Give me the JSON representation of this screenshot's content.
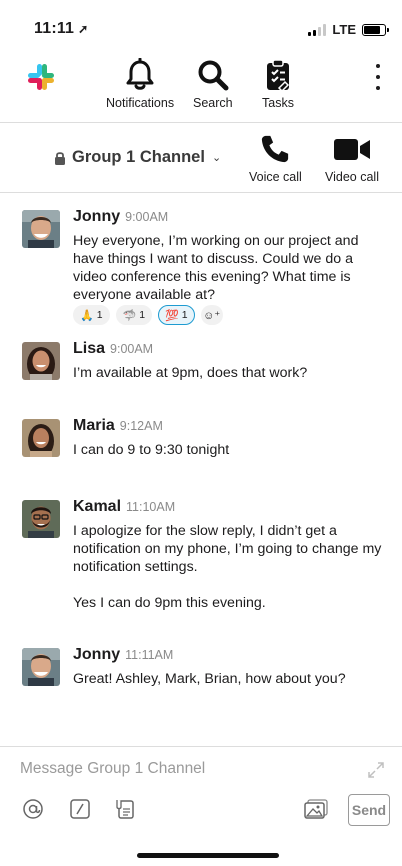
{
  "status_bar": {
    "time": "11:11",
    "network": "LTE"
  },
  "nav": {
    "notifications_label": "Notifications",
    "search_label": "Search",
    "tasks_label": "Tasks"
  },
  "channel": {
    "name": "Group 1 Channel",
    "voice_call_label": "Voice call",
    "video_call_label": "Video call"
  },
  "messages": [
    {
      "author": "Jonny",
      "time": "9:00AM",
      "text": "Hey everyone, I’m working on our project and have things I want to discuss.  Could we do a video conference this evening?  What time is everyone available at?",
      "reactions": [
        {
          "emoji": "🙏",
          "count": "1",
          "active": false
        },
        {
          "emoji": "🦈",
          "count": "1",
          "active": false
        },
        {
          "emoji": "💯",
          "count": "1",
          "active": true
        }
      ]
    },
    {
      "author": "Lisa",
      "time": "9:00AM",
      "text": "I’m available at 9pm, does that work?"
    },
    {
      "author": "Maria",
      "time": "9:12AM",
      "text": "I can do 9 to 9:30 tonight"
    },
    {
      "author": "Kamal",
      "time": "11:10AM",
      "text": "I apologize for the slow reply, I didn’t get a notification on my phone, I’m going to change my notification settings.",
      "text2": "Yes I can do 9pm this evening."
    },
    {
      "author": "Jonny",
      "time": "11:11AM",
      "text": "Great!  Ashley, Mark, Brian, how about you?"
    }
  ],
  "composer": {
    "placeholder": "Message Group 1 Channel",
    "send_label": "Send"
  },
  "colors": {
    "accent": "#1d9bd1",
    "text": "#1d1c1d",
    "muted": "#8a8a8a"
  }
}
